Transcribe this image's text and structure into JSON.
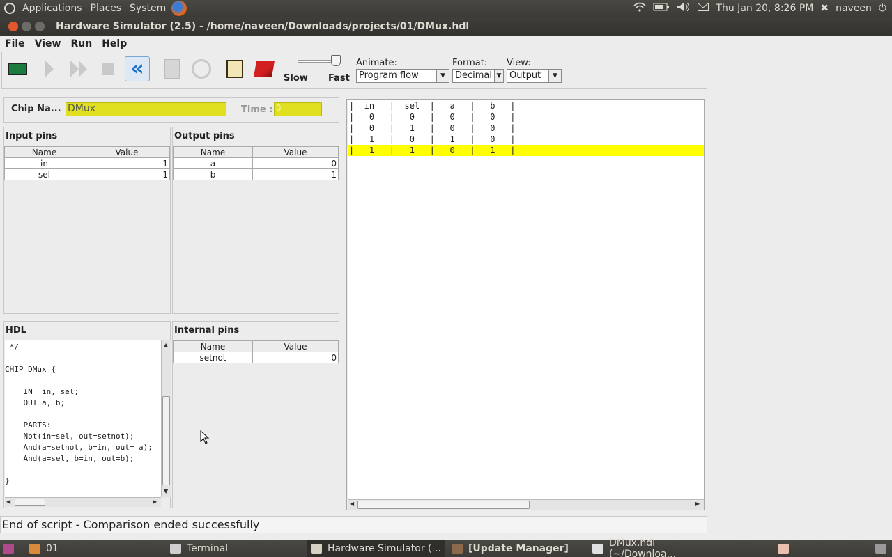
{
  "top_panel": {
    "menus": [
      "Applications",
      "Places",
      "System"
    ],
    "clock": "Thu Jan 20,  8:26 PM",
    "user": "naveen"
  },
  "window": {
    "title": "Hardware Simulator (2.5) - /home/naveen/Downloads/projects/01/DMux.hdl"
  },
  "menubar": [
    "File",
    "View",
    "Run",
    "Help"
  ],
  "toolbar": {
    "speed": {
      "slow_label": "Slow",
      "fast_label": "Fast",
      "level": 0.95
    },
    "animate": {
      "label": "Animate:",
      "value": "Program flow"
    },
    "format": {
      "label": "Format:",
      "value": "Decimal"
    },
    "view": {
      "label": "View:",
      "value": "Output"
    }
  },
  "chip": {
    "name_label": "Chip Na...",
    "name_value": "DMux",
    "time_label": "Time :",
    "time_value": "0"
  },
  "input_pins": {
    "title": "Input pins",
    "columns": [
      "Name",
      "Value"
    ],
    "rows": [
      {
        "name": "in",
        "value": "1"
      },
      {
        "name": "sel",
        "value": "1"
      }
    ]
  },
  "output_pins": {
    "title": "Output pins",
    "columns": [
      "Name",
      "Value"
    ],
    "rows": [
      {
        "name": "a",
        "value": "0"
      },
      {
        "name": "b",
        "value": "1"
      }
    ]
  },
  "hdl": {
    "title": "HDL",
    "text": " */\n\nCHIP DMux {\n\n    IN  in, sel;\n    OUT a, b;\n\n    PARTS:\n    Not(in=sel, out=setnot);\n    And(a=setnot, b=in, out= a);\n    And(a=sel, b=in, out=b);\n\n}"
  },
  "internal_pins": {
    "title": "Internal pins",
    "columns": [
      "Name",
      "Value"
    ],
    "rows": [
      {
        "name": "setnot",
        "value": "0"
      }
    ]
  },
  "output_table": {
    "rows": [
      "|  in   |  sel  |   a   |   b   |",
      "|   0   |   0   |   0   |   0   |",
      "|   0   |   1   |   0   |   0   |",
      "|   1   |   0   |   1   |   0   |",
      "|   1   |   1   |   0   |   1   |"
    ],
    "highlighted_row": 4,
    "highlight_color": "#ffff00"
  },
  "status": "End of script - Comparison ended successfully",
  "taskbar": {
    "items": [
      "01",
      "Terminal",
      "Hardware Simulator (...",
      "[Update Manager]",
      "DMux.hdl (~/Downloa..."
    ]
  }
}
